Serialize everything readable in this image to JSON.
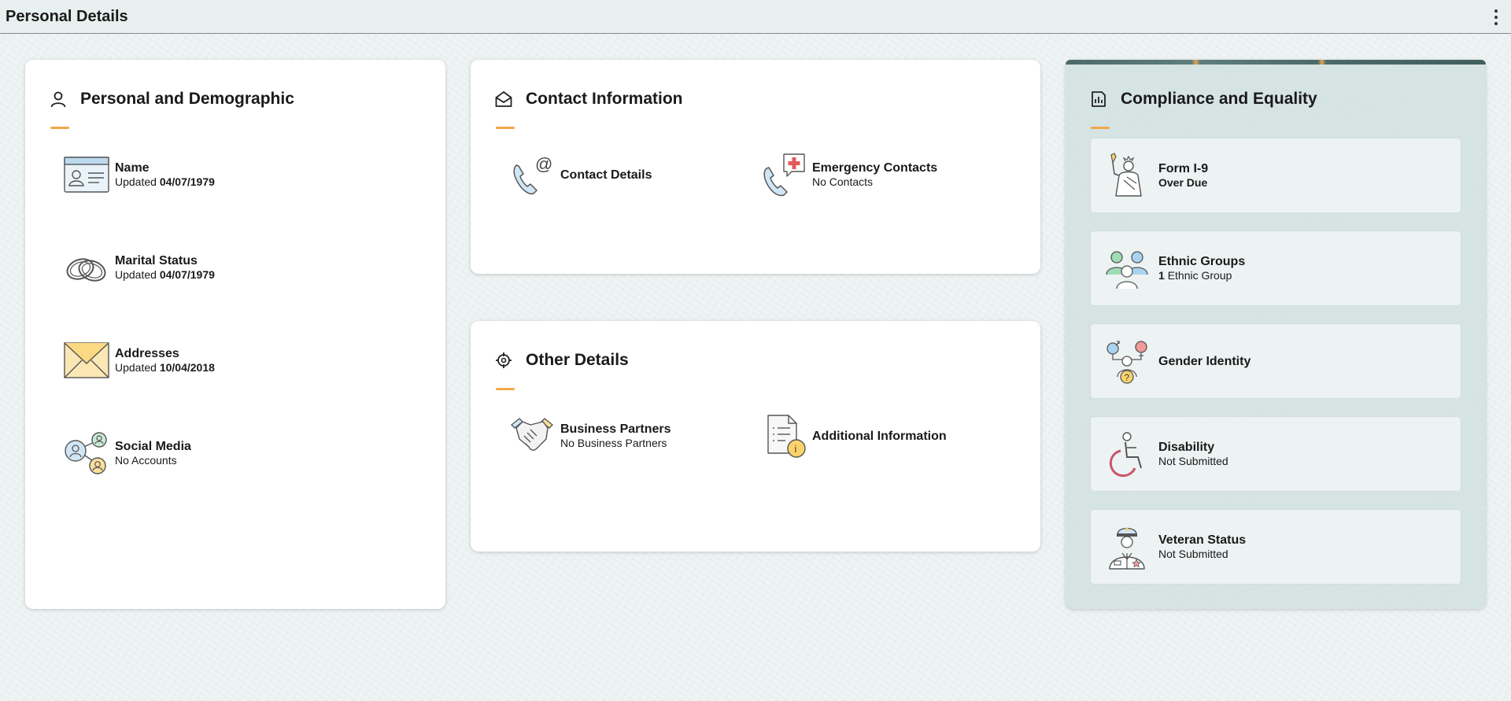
{
  "header": {
    "title": "Personal Details",
    "menu_icon": "kebab-menu-icon"
  },
  "personal": {
    "title": "Personal and Demographic",
    "icon": "person-icon",
    "accent": "#f3a64a",
    "items": [
      {
        "label": "Name",
        "sub_prefix": "Updated",
        "sub_value": "04/07/1979",
        "icon": "id-card-icon"
      },
      {
        "label": "Marital Status",
        "sub_prefix": "Updated",
        "sub_value": "04/07/1979",
        "icon": "wedding-rings-icon"
      },
      {
        "label": "Addresses",
        "sub_prefix": "Updated",
        "sub_value": "10/04/2018",
        "icon": "envelope-icon"
      },
      {
        "label": "Social Media",
        "sub": "No Accounts",
        "icon": "social-network-icon"
      }
    ]
  },
  "contact": {
    "title": "Contact Information",
    "icon": "open-envelope-icon",
    "items": [
      {
        "label": "Contact Details",
        "icon": "phone-at-icon"
      },
      {
        "label": "Emergency Contacts",
        "sub": "No Contacts",
        "icon": "phone-medical-icon"
      }
    ]
  },
  "other": {
    "title": "Other Details",
    "icon": "target-icon",
    "items": [
      {
        "label": "Business Partners",
        "sub": "No Business Partners",
        "icon": "handshake-icon"
      },
      {
        "label": "Additional Information",
        "icon": "document-info-icon"
      }
    ]
  },
  "compliance": {
    "title": "Compliance and Equality",
    "icon": "report-icon",
    "bg": "#d5e3e3",
    "items": [
      {
        "label": "Form I-9",
        "sub_bold": "Over Due",
        "icon": "statue-of-liberty-icon"
      },
      {
        "label": "Ethnic Groups",
        "sub_count": "1",
        "sub_text": "Ethnic Group",
        "icon": "people-group-icon"
      },
      {
        "label": "Gender Identity",
        "icon": "gender-symbols-icon"
      },
      {
        "label": "Disability",
        "sub": "Not Submitted",
        "icon": "wheelchair-icon"
      },
      {
        "label": "Veteran Status",
        "sub": "Not Submitted",
        "icon": "veteran-icon"
      }
    ]
  }
}
